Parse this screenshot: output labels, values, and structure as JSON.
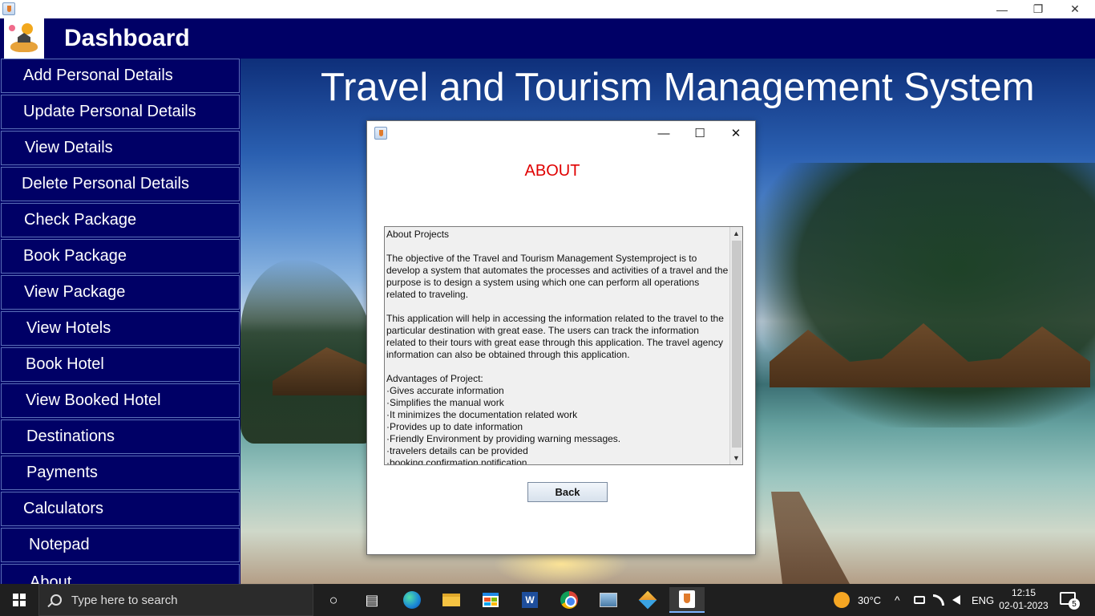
{
  "window": {
    "minimize_glyph": "—",
    "maximize_glyph": "❐",
    "close_glyph": "✕"
  },
  "header": {
    "title": "Dashboard"
  },
  "sidebar": {
    "items": [
      {
        "label": "Add Personal Details"
      },
      {
        "label": "Update Personal Details"
      },
      {
        "label": "View Details"
      },
      {
        "label": "Delete Personal Details"
      },
      {
        "label": "Check Package"
      },
      {
        "label": "Book Package"
      },
      {
        "label": "View Package"
      },
      {
        "label": "View Hotels"
      },
      {
        "label": "Book Hotel"
      },
      {
        "label": "View Booked Hotel"
      },
      {
        "label": "Destinations"
      },
      {
        "label": "Payments"
      },
      {
        "label": "Calculators"
      },
      {
        "label": "Notepad"
      },
      {
        "label": "About"
      }
    ]
  },
  "main": {
    "banner": "Travel and Tourism Management System"
  },
  "dialog": {
    "minimize_glyph": "—",
    "maximize_glyph": "☐",
    "close_glyph": "✕",
    "heading": "ABOUT",
    "about_text": "About Projects\n\nThe objective of the Travel and Tourism Management Systemproject is to develop a system that automates the processes and activities of a travel and the purpose is to design a system using which one can perform all operations related to traveling.\n\nThis application will help in accessing the information related to the travel to the particular destination with great ease. The users can track the information related to their tours with great ease through this application. The travel agency information can also be obtained through this application.\n\nAdvantages of Project:\n·Gives accurate information\n·Simplifies the manual work\n·It minimizes the documentation related work\n·Provides up to date information\n·Friendly Environment by providing warning messages.\n·travelers details can be provided\n·booking confirmation notification",
    "scroll_up_glyph": "▲",
    "scroll_down_glyph": "▼",
    "back_label": "Back"
  },
  "taskbar": {
    "search_placeholder": "Type here to search",
    "task_view_glyph": "○",
    "widgets_glyph": "▤",
    "word_letter": "W",
    "temperature": "30°C",
    "chevron_glyph": "^",
    "language": "ENG",
    "time": "12:15",
    "date": "02-01-2023",
    "notification_count": "5"
  },
  "colors": {
    "header_bg": "#000066",
    "sidebar_bg": "#000066",
    "about_heading": "#e00000",
    "taskbar_bg": "#1f1f1f"
  },
  "icons": [
    "java-app-icon",
    "travel-logo-icon",
    "search-icon",
    "windows-start-icon",
    "edge-icon",
    "file-explorer-icon",
    "store-icon",
    "word-icon",
    "chrome-icon",
    "photos-icon",
    "virtualbox-icon",
    "java-icon",
    "weather-icon",
    "notification-icon"
  ]
}
